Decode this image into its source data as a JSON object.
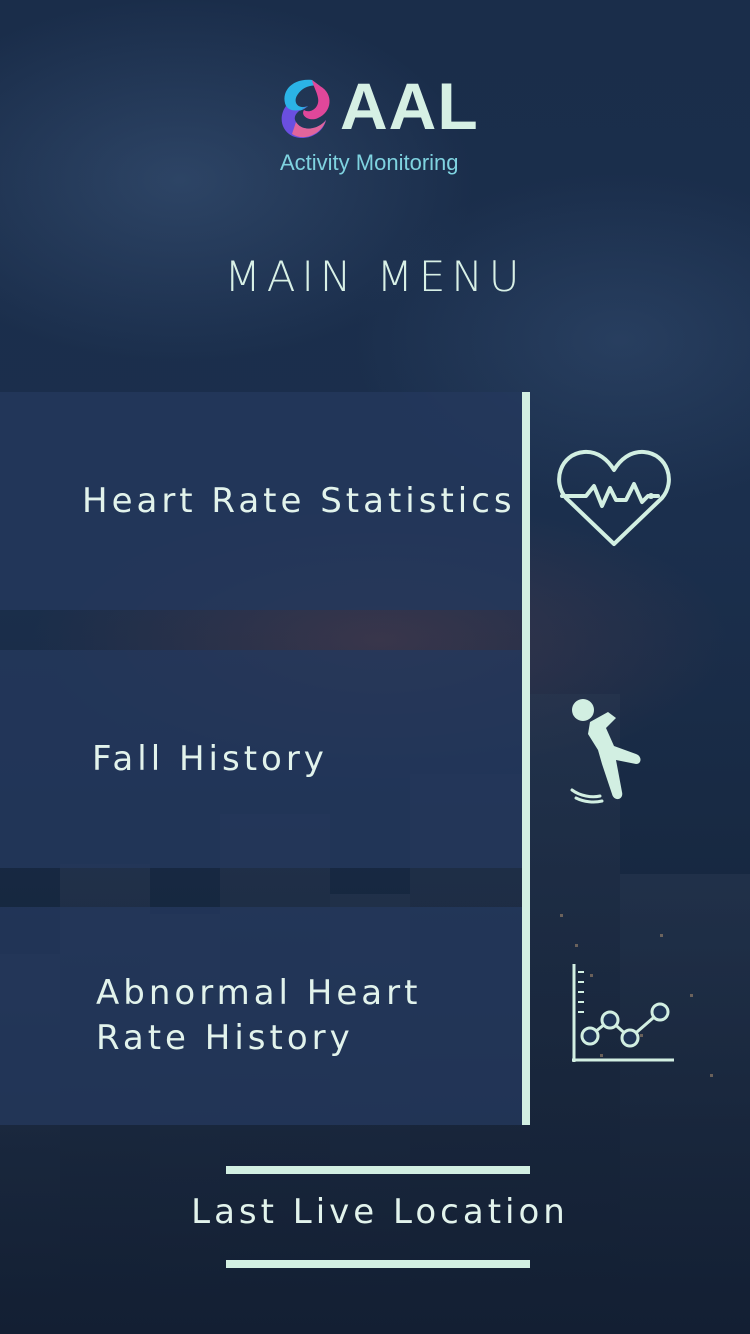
{
  "app": {
    "logo_text": "AAL",
    "logo_subtitle": "Activity Monitoring"
  },
  "header": {
    "title": "MAIN MENU"
  },
  "menu": {
    "items": [
      {
        "label": "Heart Rate Statistics",
        "icon": "heart-pulse-icon"
      },
      {
        "label": "Fall History",
        "icon": "falling-person-icon"
      },
      {
        "label": "Abnormal Heart\nRate History",
        "icon": "line-chart-icon"
      }
    ]
  },
  "footer": {
    "last_location_label": "Last Live Location"
  },
  "colors": {
    "accent": "#d2efe2",
    "panel": "#24385c",
    "logo_subtitle": "#7fd3e0",
    "background": "#1a2d4a"
  }
}
